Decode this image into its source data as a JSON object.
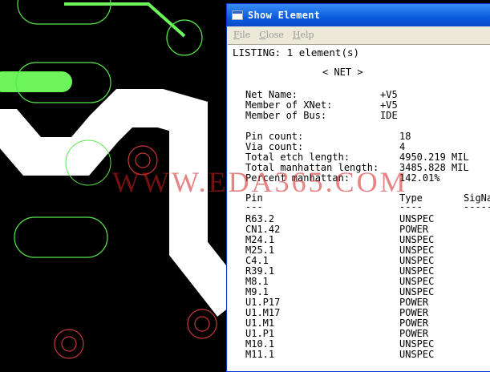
{
  "window": {
    "title": "Show Element",
    "menu": {
      "file": {
        "underline": "F",
        "rest": "ile"
      },
      "close": {
        "underline": "C",
        "rest": "lose"
      },
      "help": {
        "underline": "H",
        "rest": "elp"
      }
    }
  },
  "listing": {
    "header": "LISTING: 1 element(s)",
    "section": "< NET >",
    "net_name_label": "Net Name:",
    "net_name_value": "+V5",
    "xnet_label": "Member of XNet:",
    "xnet_value": "+V5",
    "bus_label": "Member of Bus:",
    "bus_value": "IDE",
    "pin_count_label": "Pin count:",
    "pin_count_value": "18",
    "via_count_label": "Via count:",
    "via_count_value": "4",
    "etch_label": "Total etch length:",
    "etch_value": "4950.219 MIL",
    "manhattan_label": "Total manhattan length:",
    "manhattan_value": "3485.828 MIL",
    "percent_label": "Percent manhattan:",
    "percent_value": "142.01%",
    "col_pin": "Pin",
    "col_type": "Type",
    "col_signame": "SigNa",
    "col_pin_rule": "---",
    "col_type_rule": "----",
    "col_signame_rule": "-----",
    "pins": [
      {
        "pin": "R63.2",
        "type": "UNSPEC"
      },
      {
        "pin": "CN1.42",
        "type": "POWER"
      },
      {
        "pin": "M24.1",
        "type": "UNSPEC"
      },
      {
        "pin": "M25.1",
        "type": "UNSPEC"
      },
      {
        "pin": "C4.1",
        "type": "UNSPEC"
      },
      {
        "pin": "R39.1",
        "type": "UNSPEC"
      },
      {
        "pin": "M8.1",
        "type": "UNSPEC"
      },
      {
        "pin": "M9.1",
        "type": "UNSPEC"
      },
      {
        "pin": "U1.P17",
        "type": "POWER"
      },
      {
        "pin": "U1.M17",
        "type": "POWER"
      },
      {
        "pin": "U1.M1",
        "type": "POWER"
      },
      {
        "pin": "U1.P1",
        "type": "POWER"
      },
      {
        "pin": "M10.1",
        "type": "UNSPEC"
      },
      {
        "pin": "M11.1",
        "type": "UNSPEC"
      }
    ]
  },
  "watermark": "WWW.EDA365.COM",
  "colors": {
    "pcb_background": "#000000",
    "copper_white": "#ffffff",
    "outline_green": "#57e84a",
    "fill_green": "#6cf45a",
    "via_red": "#c9363c",
    "title_blue": "#0a5ce0"
  }
}
